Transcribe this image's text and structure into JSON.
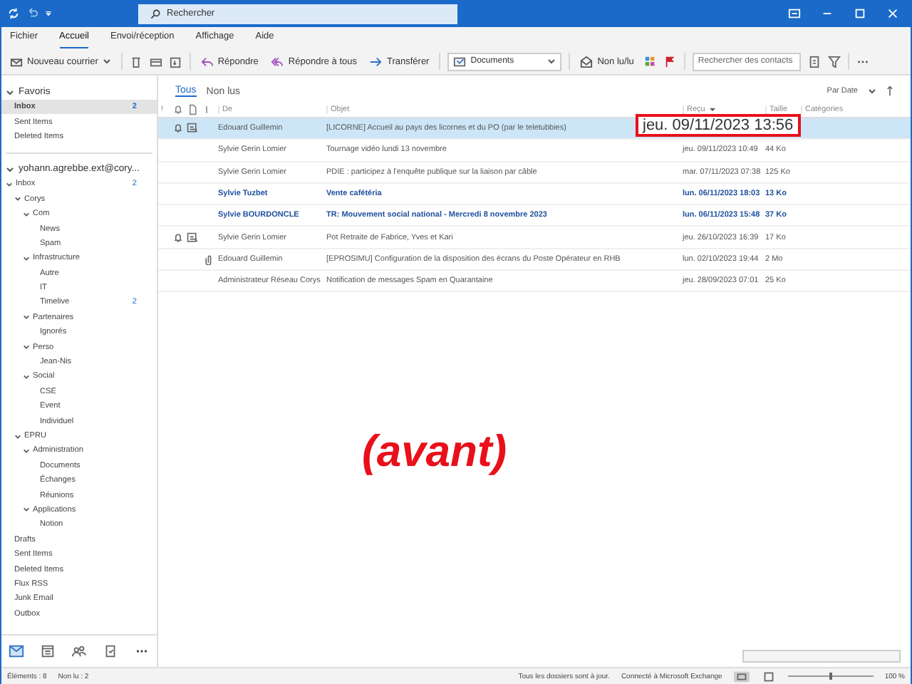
{
  "title_bar": {
    "search_placeholder": "Rechercher"
  },
  "ribbon_tabs": [
    {
      "label": "Fichier",
      "selected": false
    },
    {
      "label": "Accueil",
      "selected": true
    },
    {
      "label": "Envoi/réception",
      "selected": false
    },
    {
      "label": "Affichage",
      "selected": false
    },
    {
      "label": "Aide",
      "selected": false
    }
  ],
  "toolbar": {
    "new_mail": "Nouveau courrier",
    "reply": "Répondre",
    "reply_all": "Répondre à tous",
    "forward": "Transférer",
    "move_to": "Documents",
    "unread_read": "Non lu/lu",
    "contact_search_placeholder": "Rechercher des contacts"
  },
  "favorites": {
    "label": "Favoris",
    "expanded": true,
    "items": [
      {
        "name": "Inbox",
        "count": "2",
        "selected": true
      },
      {
        "name": "Sent Items",
        "selected": false
      },
      {
        "name": "Deleted Items",
        "selected": false
      }
    ]
  },
  "account": {
    "label": "yohann.agrebbe.ext@cory...",
    "expanded": true,
    "folders": [
      {
        "name": "Inbox",
        "count": "2",
        "expanded": true,
        "children": [
          {
            "name": "Corys",
            "expanded": true,
            "children": [
              {
                "name": "Com",
                "expanded": true,
                "children": [
                  {
                    "name": "News"
                  },
                  {
                    "name": "Spam"
                  }
                ]
              },
              {
                "name": "Infrastructure",
                "expanded": true,
                "children": [
                  {
                    "name": "Autre"
                  },
                  {
                    "name": "IT"
                  },
                  {
                    "name": "Timelive",
                    "count": "2"
                  }
                ]
              },
              {
                "name": "Partenaires",
                "expanded": true,
                "children": [
                  {
                    "name": "Ignorés"
                  }
                ]
              },
              {
                "name": "Perso",
                "expanded": true,
                "children": [
                  {
                    "name": "Jean-Nis"
                  }
                ]
              },
              {
                "name": "Social",
                "expanded": true,
                "children": [
                  {
                    "name": "CSE"
                  },
                  {
                    "name": "Event"
                  },
                  {
                    "name": "Individuel"
                  }
                ]
              }
            ]
          },
          {
            "name": "EPRU",
            "expanded": true,
            "children": [
              {
                "name": "Administration",
                "expanded": true,
                "children": [
                  {
                    "name": "Documents"
                  },
                  {
                    "name": "Échanges"
                  },
                  {
                    "name": "Réunions"
                  }
                ]
              },
              {
                "name": "Applications",
                "expanded": true,
                "children": [
                  {
                    "name": "Notion"
                  }
                ]
              }
            ]
          }
        ]
      },
      {
        "name": "Drafts"
      },
      {
        "name": "Sent Items"
      },
      {
        "name": "Deleted Items"
      },
      {
        "name": "Flux RSS"
      },
      {
        "name": "Junk Email"
      },
      {
        "name": "Outbox"
      }
    ]
  },
  "mail_list": {
    "filters": [
      {
        "label": "Tous",
        "selected": true
      },
      {
        "label": "Non lus",
        "selected": false
      }
    ],
    "sort": "Par Date",
    "columns": [
      "!",
      "De",
      "Objet",
      "Reçu",
      "Taille",
      "Catégories"
    ],
    "rows": [
      {
        "from": "Edouard Guillemin",
        "subject": "[LICORNE] Accueil au pays des licornes et du PO (par le teletubbies)",
        "unread": false,
        "selected": true,
        "reminder": true,
        "attachment": false
      },
      {
        "from": "Sylvie Gerin Lomier",
        "subject": "Tournage vidéo lundi 13 novembre",
        "received": "jeu. 09/11/2023 10:49",
        "size": "44 Ko",
        "unread": false,
        "selected": false,
        "reminder": false,
        "attachment": false
      },
      {
        "from": "Sylvie Gerin Lomier",
        "subject": "PDIE : participez à l'enquête publique sur la liaison par câble",
        "received": "mar. 07/11/2023 07:38",
        "size": "125 Ko",
        "unread": false,
        "selected": false,
        "reminder": false,
        "attachment": false
      },
      {
        "from": "Sylvie Tuzbet",
        "subject": "Vente cafétéria",
        "received": "lun. 06/11/2023 18:03",
        "size": "13 Ko",
        "unread": true,
        "selected": false,
        "reminder": false,
        "attachment": false
      },
      {
        "from": "Sylvie BOURDONCLE",
        "subject": "TR: Mouvement social national - Mercredi 8 novembre 2023",
        "received": "lun. 06/11/2023 15:48",
        "size": "37 Ko",
        "unread": true,
        "selected": false,
        "reminder": false,
        "attachment": false
      },
      {
        "from": "Sylvie Gerin Lomier",
        "subject": "Pot Retraite de Fabrice, Yves et Kari",
        "received": "jeu. 26/10/2023 16:39",
        "size": "17 Ko",
        "unread": false,
        "selected": false,
        "reminder": true,
        "attachment": false
      },
      {
        "from": "Edouard Guillemin",
        "subject": "[EPROSIMU] Configuration de la disposition des écrans du Poste Opérateur en RHB",
        "received": "lun. 02/10/2023 19:44",
        "size": "2 Mo",
        "unread": false,
        "selected": false,
        "reminder": false,
        "attachment": true
      },
      {
        "from": "Administrateur Réseau Corys",
        "subject": "Notification de messages Spam en Quarantaine",
        "received": "jeu. 28/09/2023 07:01",
        "size": "25 Ko",
        "unread": false,
        "selected": false,
        "reminder": false,
        "attachment": false
      }
    ]
  },
  "annotations": {
    "highlighted_date": "jeu. 09/11/2023 13:56",
    "caption": "(avant)"
  },
  "status_bar": {
    "items": "Éléments : 8",
    "unread": "Non lu : 2",
    "sync": "Tous les dossiers sont à jour.",
    "connection": "Connecté à Microsoft Exchange",
    "zoom": "100 %",
    "zoom_slider": {
      "level": 0.5
    }
  }
}
